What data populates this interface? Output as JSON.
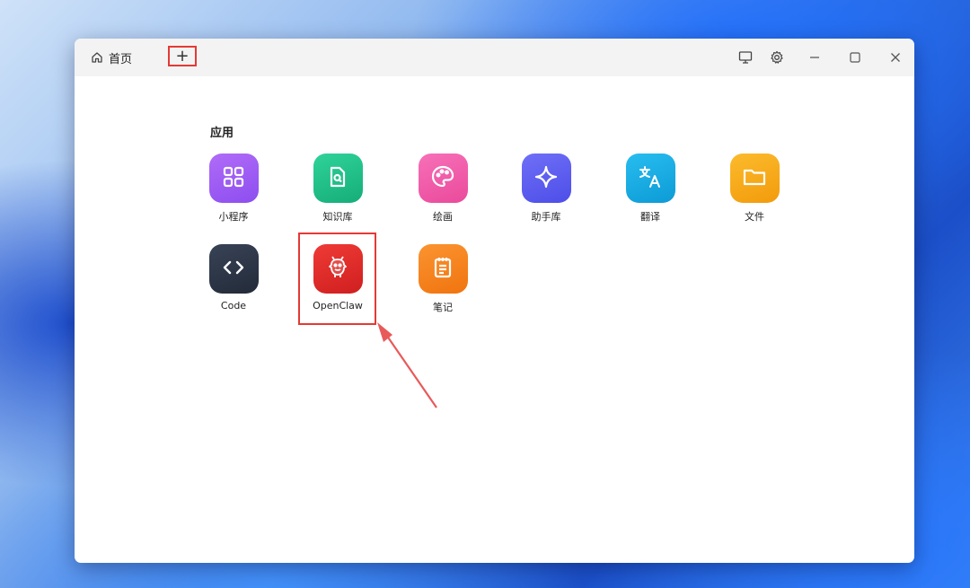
{
  "titlebar": {
    "home_tab": "首页",
    "new_tab_symbol": "+",
    "buttons": [
      "monitor-icon",
      "gear-icon",
      "minimize-icon",
      "maximize-icon",
      "close-icon"
    ]
  },
  "section": {
    "title": "应用"
  },
  "apps": [
    {
      "label": "小程序",
      "icon": "grid-icon",
      "color": "#9b5cf0"
    },
    {
      "label": "知识库",
      "icon": "document-search-icon",
      "color": "#22c08a"
    },
    {
      "label": "绘画",
      "icon": "palette-icon",
      "color": "#f05aa8"
    },
    {
      "label": "助手库",
      "icon": "sparkle-icon",
      "color": "#5b5cf0"
    },
    {
      "label": "翻译",
      "icon": "translate-icon",
      "color": "#16a9e0"
    },
    {
      "label": "文件",
      "icon": "folder-icon",
      "color": "#f6a612"
    },
    {
      "label": "Code",
      "icon": "code-icon",
      "color": "#2c3544"
    },
    {
      "label": "OpenClaw",
      "icon": "claw-mascot-icon",
      "color": "#e02828"
    },
    {
      "label": "笔记",
      "icon": "notepad-icon",
      "color": "#f7811c"
    }
  ],
  "annotation": {
    "highlight_color": "#e53935"
  }
}
